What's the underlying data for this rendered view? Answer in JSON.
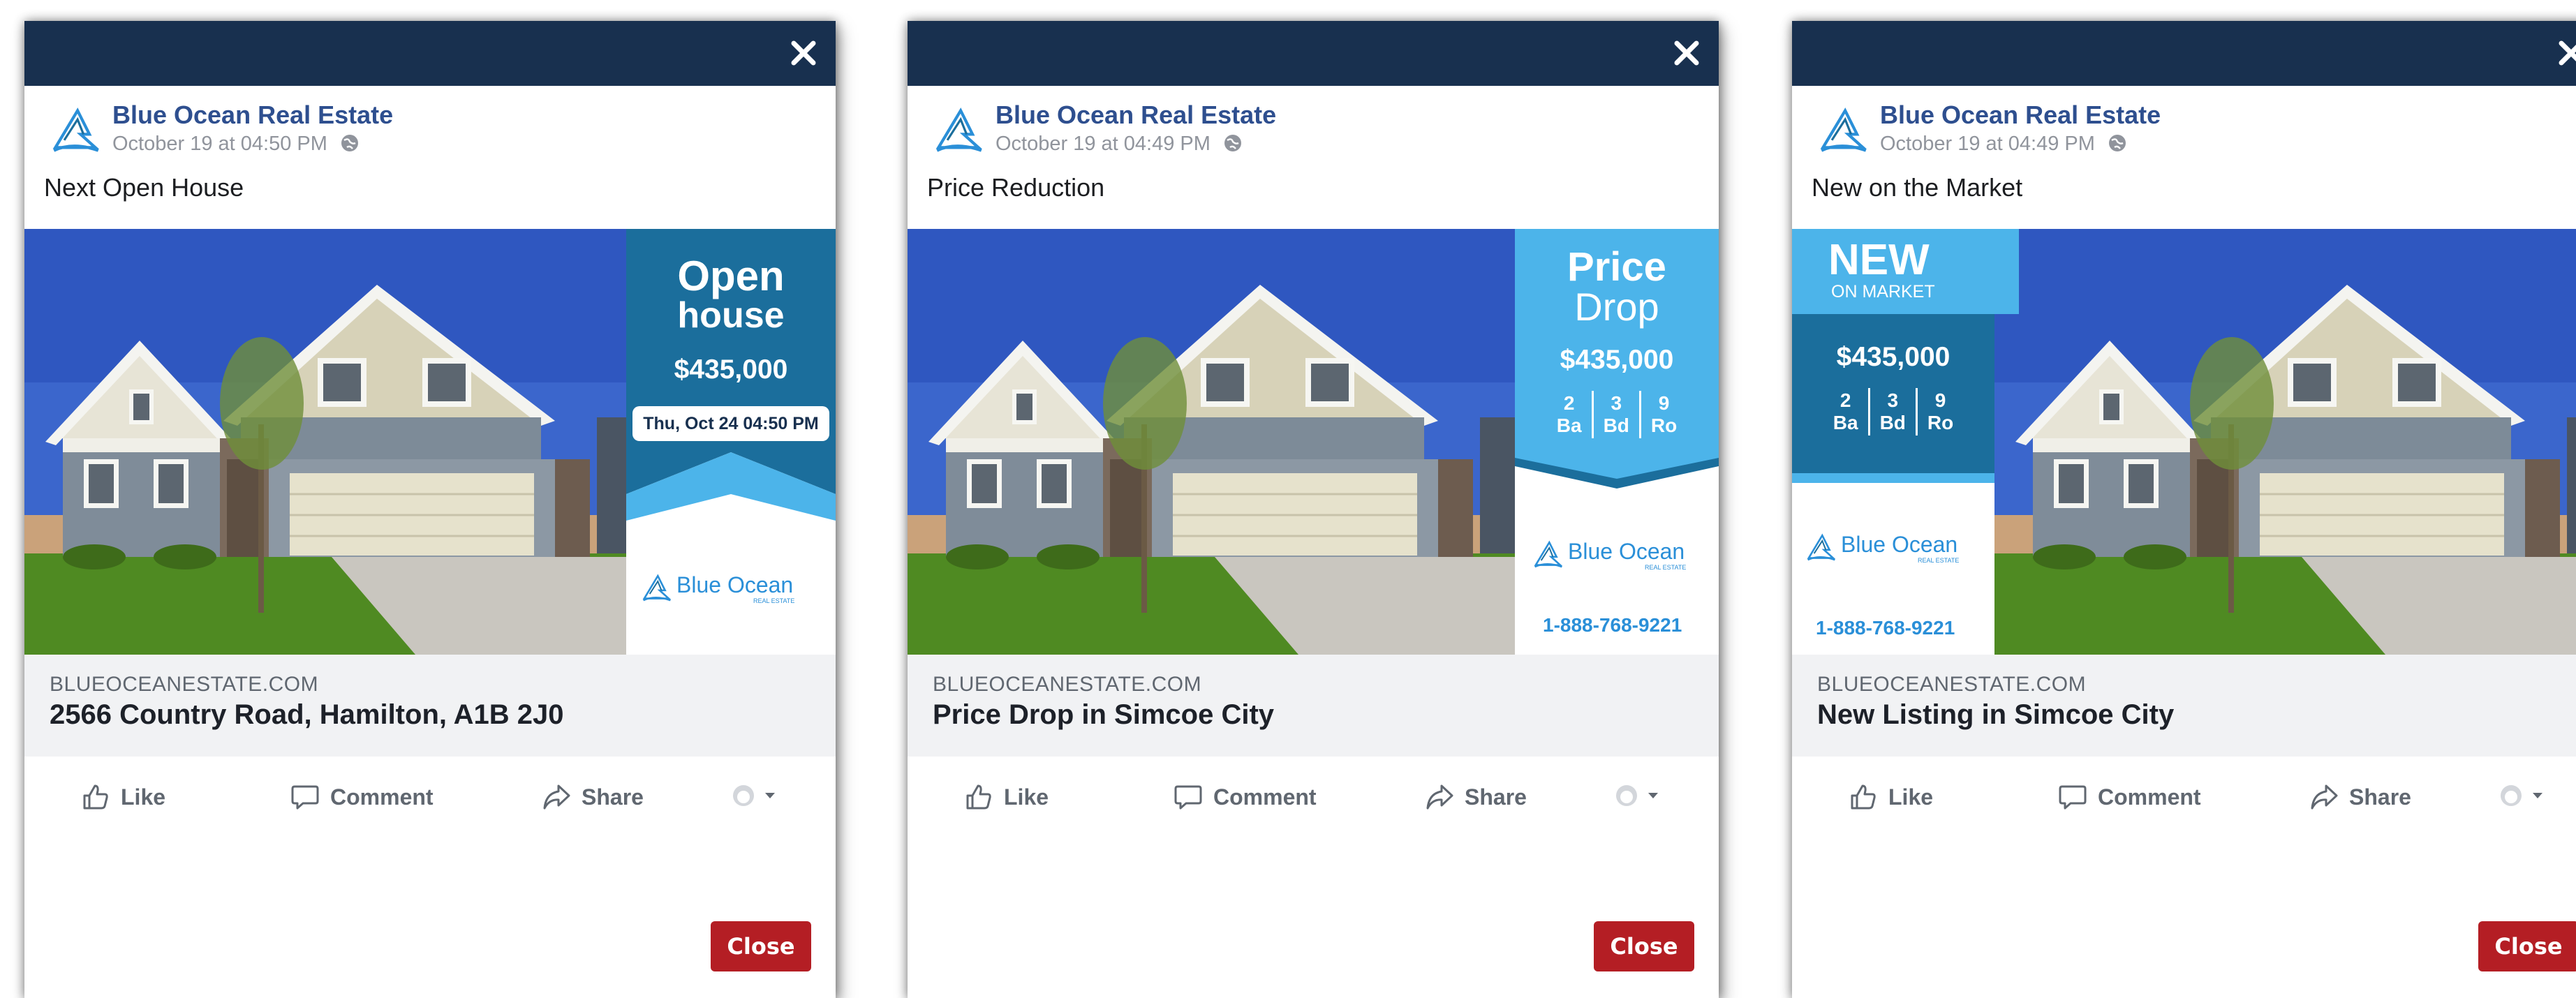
{
  "brand": {
    "navy": "#18304f",
    "name_blue": "#2e4f8f",
    "teal_dark": "#1b6e9c",
    "sky": "#4cb4ea",
    "close_red": "#b41e24"
  },
  "cards": [
    {
      "page_name": "Blue Ocean Real Estate",
      "timestamp": "October 19 at 04:50 PM",
      "post_text": "Next Open House",
      "flyer": {
        "headline_1": "Open",
        "headline_2": "house",
        "price": "$435,000",
        "date_badge": "Thu, Oct 24 04:50 PM",
        "brand_main": "Blue Ocean",
        "brand_sub": "REAL ESTATE"
      },
      "link_domain": "BLUEOCEANESTATE.COM",
      "link_title": "2566 Country Road, Hamilton, A1B 2J0",
      "actions": {
        "like": "Like",
        "comment": "Comment",
        "share": "Share"
      },
      "close_label": "Close",
      "icons": [
        "close-icon",
        "logo-icon",
        "globe-icon",
        "like-icon",
        "comment-icon",
        "share-icon",
        "avatar-icon",
        "caret-down-icon"
      ]
    },
    {
      "page_name": "Blue Ocean Real Estate",
      "timestamp": "October 19 at 04:49 PM",
      "post_text": "Price Reduction",
      "flyer": {
        "headline_1": "Price",
        "headline_2": "Drop",
        "price": "$435,000",
        "stats": [
          {
            "value": "2",
            "label": "Ba"
          },
          {
            "value": "3",
            "label": "Bd"
          },
          {
            "value": "9",
            "label": "Ro"
          }
        ],
        "brand_main": "Blue Ocean",
        "brand_sub": "REAL ESTATE",
        "phone": "1-888-768-9221"
      },
      "link_domain": "BLUEOCEANESTATE.COM",
      "link_title": "Price Drop in Simcoe City",
      "actions": {
        "like": "Like",
        "comment": "Comment",
        "share": "Share"
      },
      "close_label": "Close"
    },
    {
      "page_name": "Blue Ocean Real Estate",
      "timestamp": "October 19 at 04:49 PM",
      "post_text": "New on the Market",
      "flyer": {
        "headline_1": "NEW",
        "headline_2": "ON MARKET",
        "price": "$435,000",
        "stats": [
          {
            "value": "2",
            "label": "Ba"
          },
          {
            "value": "3",
            "label": "Bd"
          },
          {
            "value": "9",
            "label": "Ro"
          }
        ],
        "brand_main": "Blue Ocean",
        "brand_sub": "REAL ESTATE",
        "phone": "1-888-768-9221"
      },
      "link_domain": "BLUEOCEANESTATE.COM",
      "link_title": "New Listing in Simcoe City",
      "actions": {
        "like": "Like",
        "comment": "Comment",
        "share": "Share"
      },
      "close_label": "Close"
    }
  ]
}
